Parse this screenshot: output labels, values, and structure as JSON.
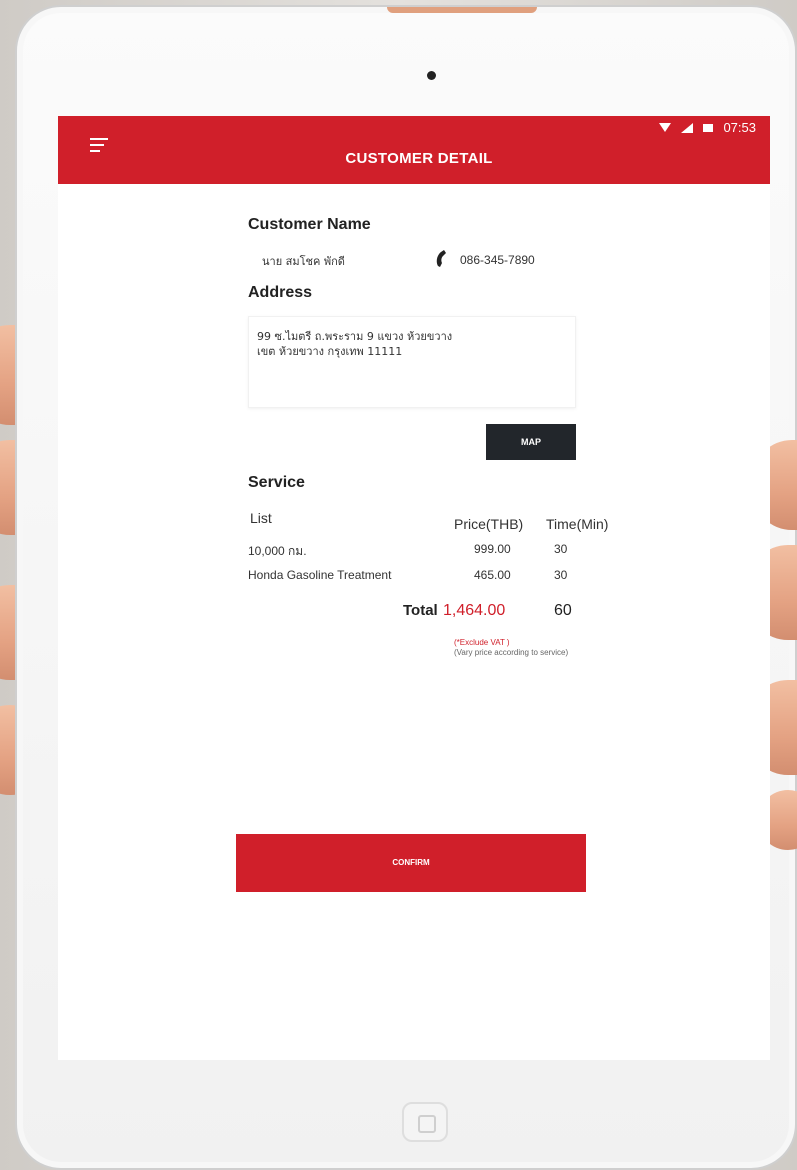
{
  "status_bar": {
    "time": "07:53"
  },
  "header": {
    "title": "CUSTOMER DETAIL"
  },
  "customer": {
    "heading": "Customer Name",
    "name": "นาย สมโชค พักดี",
    "phone": "086-345-7890"
  },
  "address": {
    "heading": "Address",
    "line1": "99 ซ.ไมตรี ถ.พระราม 9 แขวง ห้วยขวาง",
    "line2": "เขต ห้วยขวาง กรุงเทพ 11111"
  },
  "map_button": {
    "label": "MAP"
  },
  "service": {
    "heading": "Service",
    "columns": {
      "list": "List",
      "price": "Price(THB)",
      "time": "Time(Min)"
    },
    "rows": [
      {
        "name": "10,000 กม.",
        "price": "999.00",
        "time": "30"
      },
      {
        "name": "Honda Gasoline Treatment",
        "price": "465.00",
        "time": "30"
      }
    ],
    "total_label": "Total",
    "total_price": "1,464.00",
    "total_time": "60",
    "note_vat": "(*Exclude VAT )",
    "note_vary": "(Vary price according to service)"
  },
  "confirm_button": {
    "label": "CONFIRM"
  },
  "colors": {
    "brand_red": "#d01f2a",
    "map_button_bg": "#22262b"
  }
}
